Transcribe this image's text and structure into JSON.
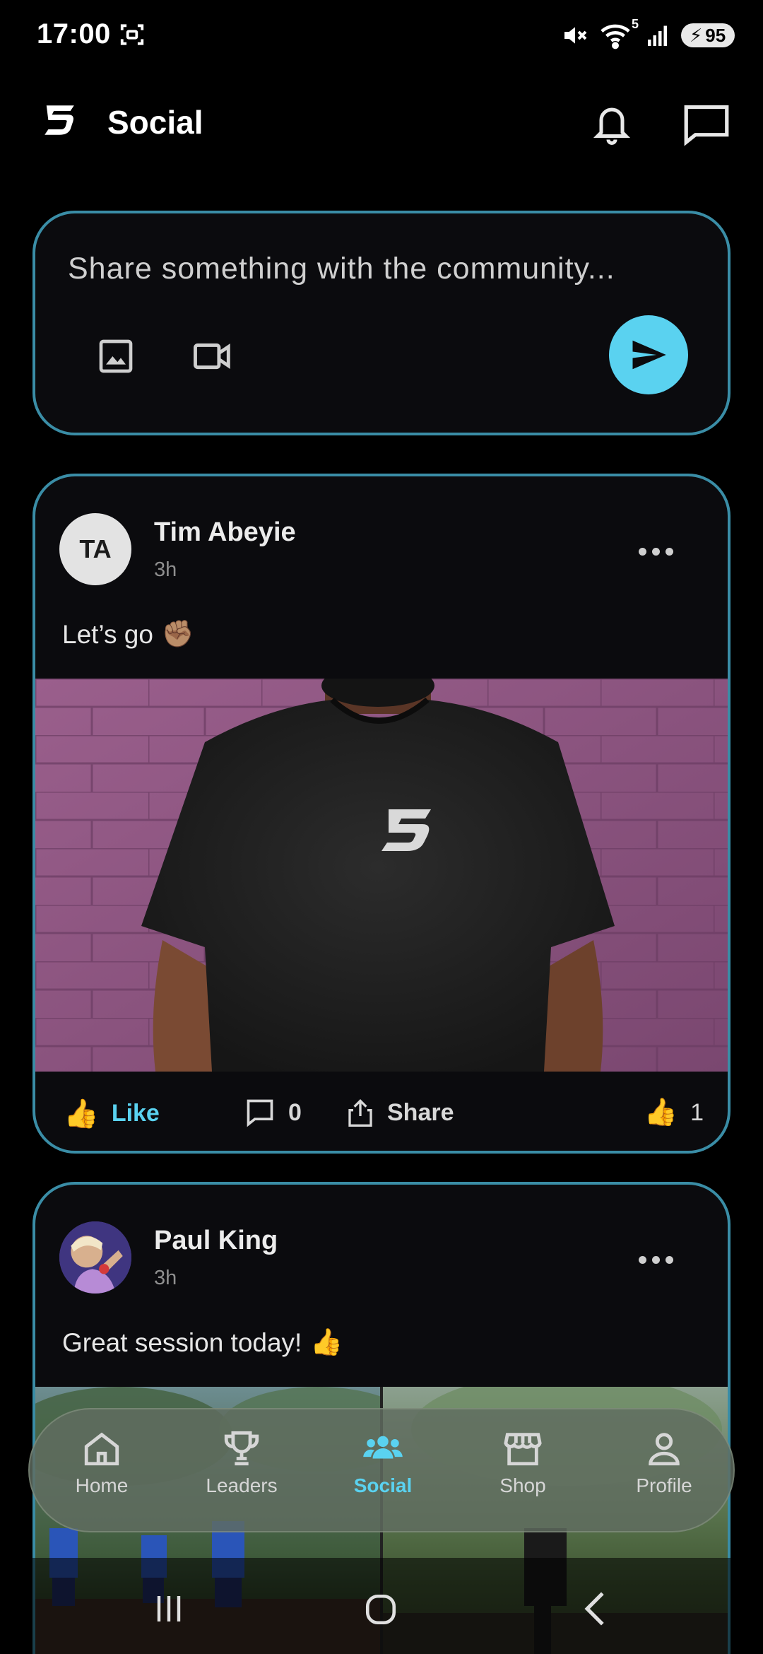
{
  "status_bar": {
    "time": "17:00",
    "battery": "95",
    "network": "5"
  },
  "app_bar": {
    "title": "Social"
  },
  "composer": {
    "placeholder": "Share something with the community..."
  },
  "posts": [
    {
      "avatar_initials": "TA",
      "author": "Tim Abeyie",
      "time": "3h",
      "text": "Let’s go",
      "emoji": "✊🏽",
      "actions": {
        "like": "Like",
        "comments": "0",
        "share": "Share",
        "like_count": "1"
      }
    },
    {
      "author": "Paul King",
      "time": "3h",
      "text": "Great session today!",
      "emoji": "👍"
    }
  ],
  "bottom_nav": {
    "items": [
      {
        "label": "Home",
        "icon": "home-icon"
      },
      {
        "label": "Leaders",
        "icon": "trophy-icon"
      },
      {
        "label": "Social",
        "icon": "people-icon",
        "active": true
      },
      {
        "label": "Shop",
        "icon": "store-icon"
      },
      {
        "label": "Profile",
        "icon": "person-icon"
      }
    ]
  },
  "colors": {
    "accent": "#5ad2f0",
    "card_border": "#3a8da6",
    "background": "#000000"
  }
}
